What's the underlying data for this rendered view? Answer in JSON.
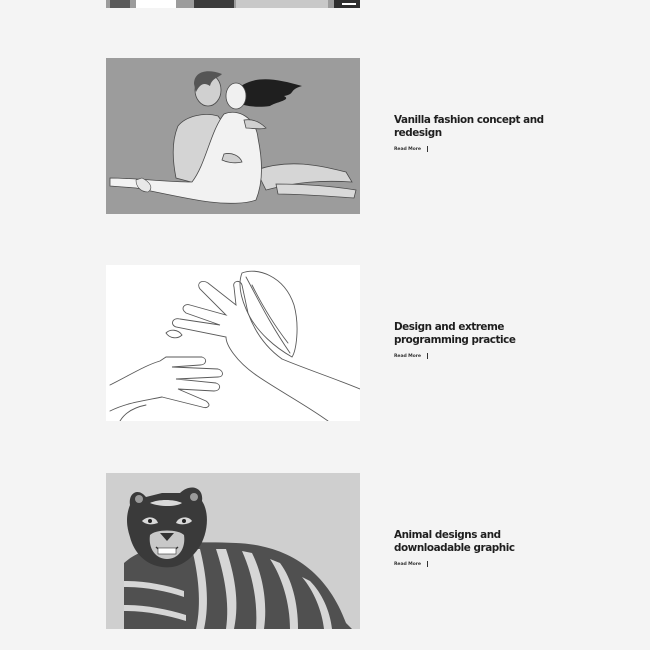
{
  "posts": [
    {
      "title": "Vanilla fashion concept and redesign",
      "read_more": "Read More",
      "image": "couple-embrace-illustration"
    },
    {
      "title": "Design and extreme programming practice",
      "read_more": "Read More",
      "image": "hands-line-art-illustration"
    },
    {
      "title": "Animal designs and downloadable graphic",
      "read_more": "Read More",
      "image": "tiger-illustration"
    }
  ],
  "colors": {
    "background": "#f4f4f4",
    "text": "#1e1e1e",
    "image_gray": "#9c9c9c",
    "image_light": "#c8c8c8"
  }
}
